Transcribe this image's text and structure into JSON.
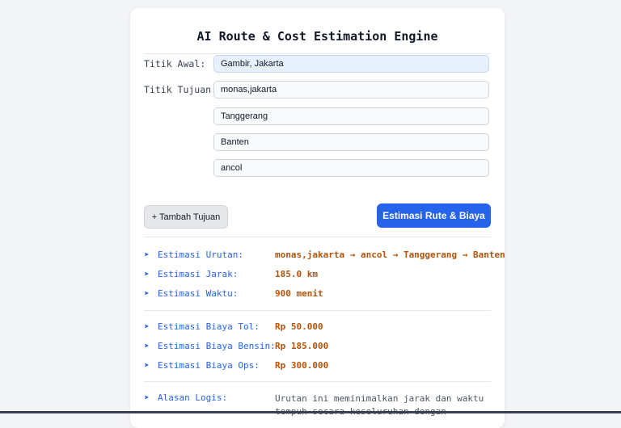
{
  "title": "AI Route & Cost Estimation Engine",
  "form": {
    "origin_label": "Titik Awal:",
    "origin_value": "Gambir, Jakarta",
    "destination_label": "Titik Tujuan:",
    "destinations": [
      "monas,jakarta",
      "Tanggerang",
      "Banten",
      "ancol"
    ]
  },
  "buttons": {
    "add_destination": "+ Tambah Tujuan",
    "estimate": "Estimasi Rute & Biaya"
  },
  "results": {
    "order_label": "Estimasi Urutan:",
    "order_value": "monas,jakarta → ancol → Tanggerang → Banten",
    "distance_label": "Estimasi Jarak:",
    "distance_value": "185.0 km",
    "time_label": "Estimasi Waktu:",
    "time_value": "900 menit",
    "toll_label": "Estimasi Biaya Tol:",
    "toll_value": "Rp 50.000",
    "fuel_label": "Estimasi Biaya Bensin:",
    "fuel_value": "Rp 185.000",
    "ops_label": "Estimasi Biaya Ops:",
    "ops_value": "Rp 300.000",
    "reason_label": "Alasan Logis:",
    "reason_value": "Urutan ini meminimalkan jarak dan waktu tempuh secara keseluruhan dengan"
  },
  "icons": {
    "bullet": "➤"
  },
  "colors": {
    "accent": "#2563eb",
    "value": "#b45309"
  }
}
